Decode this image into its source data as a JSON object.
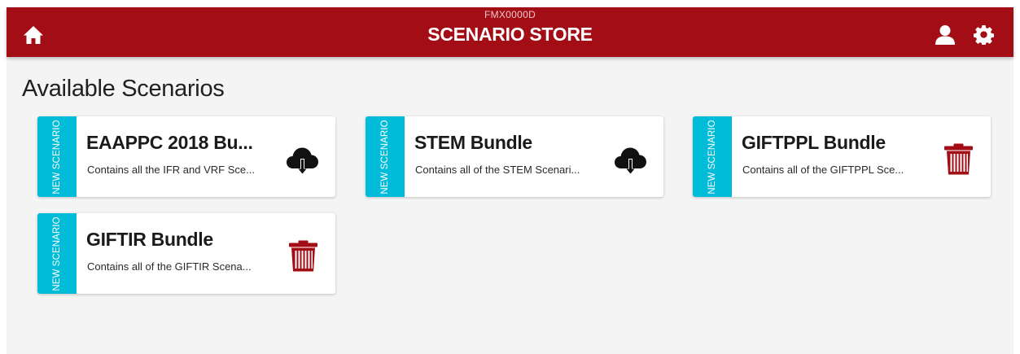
{
  "header": {
    "subtitle": "FMX0000D",
    "title": "SCENARIO STORE",
    "icons": {
      "home": "home-icon",
      "user": "user-icon",
      "settings": "gear-icon"
    },
    "background_color": "#a30d16"
  },
  "page": {
    "title": "Available Scenarios"
  },
  "colors": {
    "tag": "#00bcd9",
    "delete": "#a30d16",
    "download": "#111111"
  },
  "cards": [
    {
      "tag": "NEW SCENARIO",
      "title": "EAAPPC 2018 Bu...",
      "description": "Contains all the IFR and VRF Sce...",
      "action_icon": "cloud-download-icon"
    },
    {
      "tag": "NEW SCENARIO",
      "title": "STEM Bundle",
      "description": "Contains all of the STEM Scenari...",
      "action_icon": "cloud-download-icon"
    },
    {
      "tag": "NEW SCENARIO",
      "title": "GIFTPPL Bundle",
      "description": "Contains all of the GIFTPPL Sce...",
      "action_icon": "trash-icon"
    },
    {
      "tag": "NEW SCENARIO",
      "title": "GIFTIR Bundle",
      "description": "Contains all of the GIFTIR Scena...",
      "action_icon": "trash-icon"
    }
  ]
}
